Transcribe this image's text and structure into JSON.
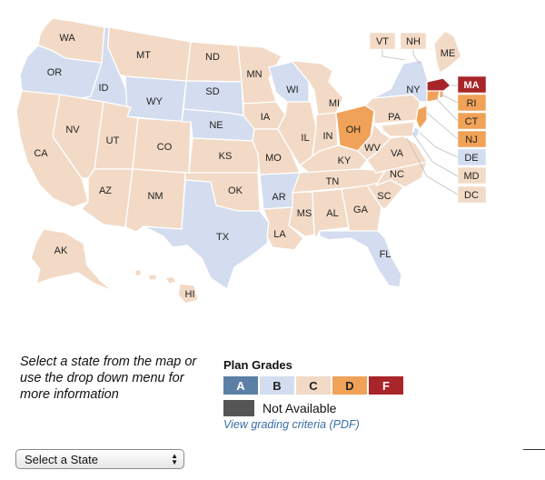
{
  "colors": {
    "A": "#5b7fa5",
    "B": "#d3ddef",
    "C": "#f2dac6",
    "D": "#f0a258",
    "F": "#a8252a",
    "na": "#555555",
    "link": "#3b6ea5"
  },
  "states": {
    "WA": {
      "label": "WA",
      "grade": "C"
    },
    "OR": {
      "label": "OR",
      "grade": "B"
    },
    "CA": {
      "label": "CA",
      "grade": "C"
    },
    "ID": {
      "label": "ID",
      "grade": "B"
    },
    "NV": {
      "label": "NV",
      "grade": "C"
    },
    "MT": {
      "label": "MT",
      "grade": "C"
    },
    "WY": {
      "label": "WY",
      "grade": "B"
    },
    "UT": {
      "label": "UT",
      "grade": "C"
    },
    "AZ": {
      "label": "AZ",
      "grade": "C"
    },
    "CO": {
      "label": "CO",
      "grade": "C"
    },
    "NM": {
      "label": "NM",
      "grade": "C"
    },
    "ND": {
      "label": "ND",
      "grade": "C"
    },
    "SD": {
      "label": "SD",
      "grade": "B"
    },
    "NE": {
      "label": "NE",
      "grade": "B"
    },
    "KS": {
      "label": "KS",
      "grade": "C"
    },
    "OK": {
      "label": "OK",
      "grade": "C"
    },
    "TX": {
      "label": "TX",
      "grade": "B"
    },
    "MN": {
      "label": "MN",
      "grade": "C"
    },
    "IA": {
      "label": "IA",
      "grade": "C"
    },
    "MO": {
      "label": "MO",
      "grade": "C"
    },
    "AR": {
      "label": "AR",
      "grade": "B"
    },
    "LA": {
      "label": "LA",
      "grade": "C"
    },
    "WI": {
      "label": "WI",
      "grade": "B"
    },
    "IL": {
      "label": "IL",
      "grade": "C"
    },
    "MI": {
      "label": "MI",
      "grade": "C"
    },
    "IN": {
      "label": "IN",
      "grade": "C"
    },
    "OH": {
      "label": "OH",
      "grade": "D"
    },
    "KY": {
      "label": "KY",
      "grade": "C"
    },
    "TN": {
      "label": "TN",
      "grade": "C"
    },
    "MS": {
      "label": "MS",
      "grade": "C"
    },
    "AL": {
      "label": "AL",
      "grade": "C"
    },
    "GA": {
      "label": "GA",
      "grade": "C"
    },
    "FL": {
      "label": "FL",
      "grade": "B"
    },
    "SC": {
      "label": "SC",
      "grade": "C"
    },
    "NC": {
      "label": "NC",
      "grade": "C"
    },
    "VA": {
      "label": "VA",
      "grade": "C"
    },
    "WV": {
      "label": "WV",
      "grade": "C"
    },
    "PA": {
      "label": "PA",
      "grade": "C"
    },
    "NY": {
      "label": "NY",
      "grade": "B"
    },
    "ME": {
      "label": "ME",
      "grade": "C"
    },
    "AK": {
      "label": "AK",
      "grade": "C"
    },
    "HI": {
      "label": "HI",
      "grade": "C"
    },
    "VT": {
      "label": "VT",
      "grade": "C"
    },
    "NH": {
      "label": "NH",
      "grade": "C"
    },
    "MA": {
      "label": "MA",
      "grade": "F"
    },
    "RI": {
      "label": "RI",
      "grade": "D"
    },
    "CT": {
      "label": "CT",
      "grade": "D"
    },
    "NJ": {
      "label": "NJ",
      "grade": "D"
    },
    "DE": {
      "label": "DE",
      "grade": "B"
    },
    "MD": {
      "label": "MD",
      "grade": "C"
    },
    "DC": {
      "label": "DC",
      "grade": "C"
    }
  },
  "instructions": "Select a state from the map or use the drop down menu for more information",
  "legend": {
    "title": "Plan Grades",
    "grades": [
      {
        "label": "A",
        "key": "A"
      },
      {
        "label": "B",
        "key": "B"
      },
      {
        "label": "C",
        "key": "C"
      },
      {
        "label": "D",
        "key": "D"
      },
      {
        "label": "F",
        "key": "F"
      }
    ],
    "not_available": "Not Available",
    "criteria_link": "View grading criteria (PDF)"
  },
  "select": {
    "value": "Select a State"
  }
}
